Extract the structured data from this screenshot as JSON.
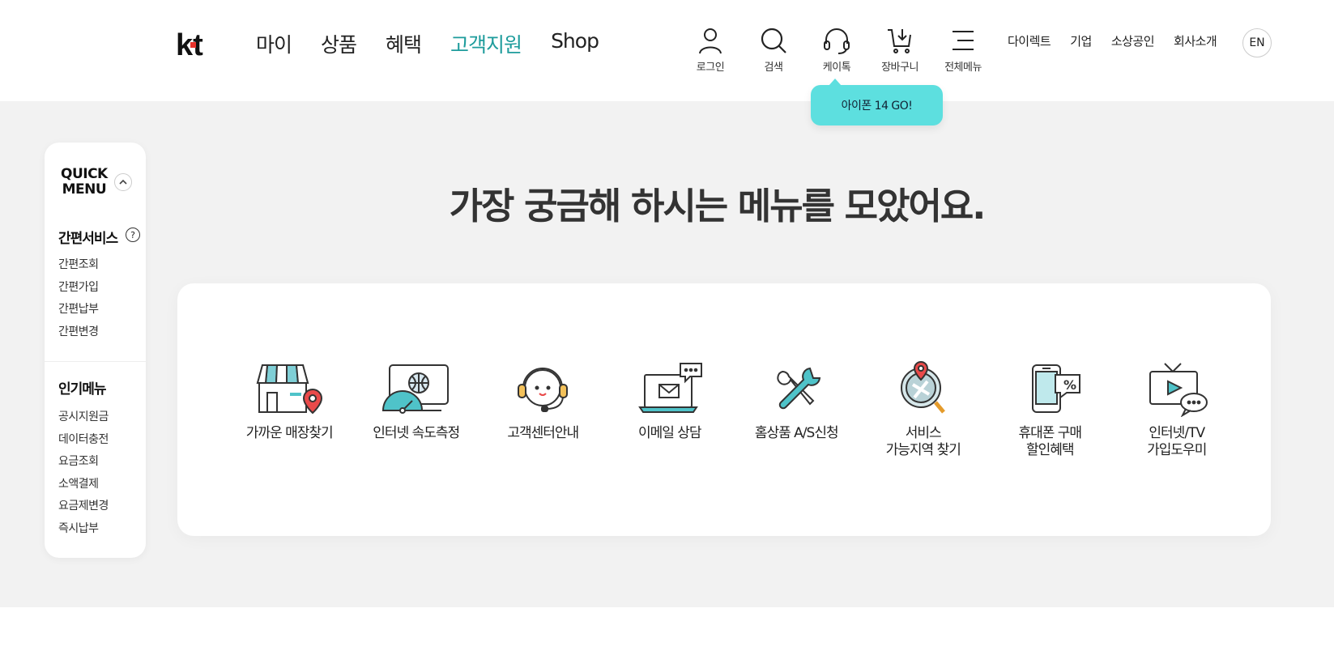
{
  "header": {
    "logo_text": "kt",
    "nav": [
      "마이",
      "상품",
      "혜택",
      "고객지원",
      "Shop"
    ],
    "utility": [
      "로그인",
      "검색",
      "케이톡",
      "장바구니",
      "전체메뉴"
    ],
    "links": [
      "다이렉트",
      "기업",
      "소상공인",
      "회사소개"
    ],
    "language": "EN",
    "ktalk_promo": "아이폰 14 GO!"
  },
  "quick_menu": {
    "title_line1": "QUICK",
    "title_line2": "MENU",
    "toggle_icon": "chevron-up-icon",
    "easy_service": {
      "heading": "간편서비스",
      "help": "?",
      "items": [
        "간편조회",
        "간편가입",
        "간편납부",
        "간편변경"
      ]
    },
    "popular": {
      "heading": "인기메뉴",
      "items": [
        "공시지원금",
        "데이터충전",
        "요금조회",
        "소액결제",
        "요금제변경",
        "즉시납부"
      ]
    }
  },
  "main": {
    "headline": "가장 궁금해 하시는 메뉴를 모았어요.",
    "menu": [
      {
        "label": "가까운 매장찾기",
        "icon": "store-location-icon"
      },
      {
        "label": "인터넷 속도측정",
        "icon": "speed-test-icon"
      },
      {
        "label": "고객센터안내",
        "icon": "headset-icon"
      },
      {
        "label": "이메일 상담",
        "icon": "email-laptop-icon"
      },
      {
        "label": "홈상품 A/S신청",
        "icon": "repair-tools-icon"
      },
      {
        "label": "서비스\n가능지역 찾기",
        "icon": "coverage-search-icon"
      },
      {
        "label": "휴대폰 구매\n할인혜택",
        "icon": "phone-discount-icon"
      },
      {
        "label": "인터넷/TV\n가입도우미",
        "icon": "tv-chat-icon"
      }
    ]
  },
  "colors": {
    "accent": "#1e9c9c",
    "promo_bubble": "#5ddfdf",
    "background": "#f2f2f2",
    "logo_red": "#e8322b"
  }
}
